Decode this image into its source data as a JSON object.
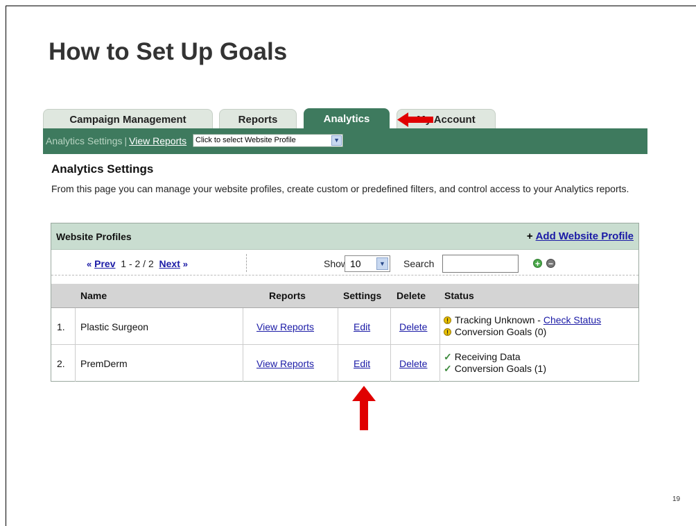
{
  "slide": {
    "title": "How to Set Up Goals",
    "page_number": "19"
  },
  "tabs": [
    {
      "label": "Campaign Management",
      "active": false
    },
    {
      "label": "Reports",
      "active": false
    },
    {
      "label": "Analytics",
      "active": true
    },
    {
      "label": "My Account",
      "active": false
    }
  ],
  "subnav": {
    "current": "Analytics Settings",
    "separator": "|",
    "view_reports": "View Reports",
    "profile_select": "Click to select Website Profile"
  },
  "settings": {
    "heading": "Analytics Settings",
    "description": "From this page you can manage your website profiles, create custom or predefined filters, and control access to your Analytics reports."
  },
  "profiles_panel": {
    "title": "Website Profiles",
    "add_plus": "+",
    "add_label": "Add Website Profile",
    "pager": {
      "prev_arrow": "«",
      "prev": "Prev",
      "range": "1 - 2 / 2",
      "next": "Next",
      "next_arrow": "»"
    },
    "show_label": "Show",
    "show_value": "10",
    "search_label": "Search",
    "search_value": ""
  },
  "table": {
    "headers": {
      "name": "Name",
      "reports": "Reports",
      "settings": "Settings",
      "delete": "Delete",
      "status": "Status"
    },
    "rows": [
      {
        "num": "1.",
        "name": "Plastic Surgeon",
        "reports": "View Reports",
        "settings": "Edit",
        "delete": "Delete",
        "status1_text": "Tracking Unknown - ",
        "status1_link": "Check Status",
        "status2_text": "Conversion Goals (0)"
      },
      {
        "num": "2.",
        "name": "PremDerm",
        "reports": "View Reports",
        "settings": "Edit",
        "delete": "Delete",
        "status1_text": "Receiving Data",
        "status2_text": "Conversion Goals (1)"
      }
    ]
  },
  "colors": {
    "accent_green": "#3e7a5e",
    "panel_header": "#c9ddd0",
    "link_blue": "#1a1aa6",
    "annotation_red": "#e00000"
  }
}
